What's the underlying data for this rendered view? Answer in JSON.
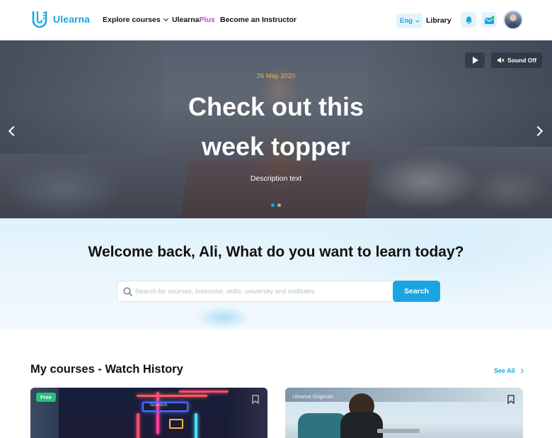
{
  "brand": {
    "name": "Ulearna"
  },
  "nav": {
    "explore_label": "Explore courses",
    "plus_prefix": "Ulearna",
    "plus_suffix": "Plus",
    "instructor_label": "Become an Instructor",
    "language": "Eng",
    "library_label": "Library"
  },
  "hero": {
    "date": "26 May 2020",
    "title": "Check out this week topper",
    "description": "Description text",
    "sound_label": "Sound Off",
    "slide_count": 2,
    "active_slide": 1
  },
  "welcome": {
    "title": "Welcome back, Ali, What do you want to learn today?",
    "search_placeholder": "Search for courses, instructor, skills, university and institutes",
    "search_button": "Search"
  },
  "courses": {
    "section_title": "My courses - Watch History",
    "see_all": "See All",
    "cards": [
      {
        "badge": "Free",
        "sign": "facebook"
      },
      {
        "label": "Ulearna Originals"
      }
    ]
  },
  "colors": {
    "accent": "#1ba5e0",
    "plus": "#b84fd6",
    "date": "#f0b43b",
    "free_badge": "#21c27a"
  },
  "icons": {
    "logo": "ulearna-logo-icon",
    "bell": "bell-icon",
    "mail": "mail-icon",
    "search": "search-icon",
    "play": "play-icon",
    "sound": "sound-off-icon",
    "bookmark": "bookmark-icon"
  }
}
